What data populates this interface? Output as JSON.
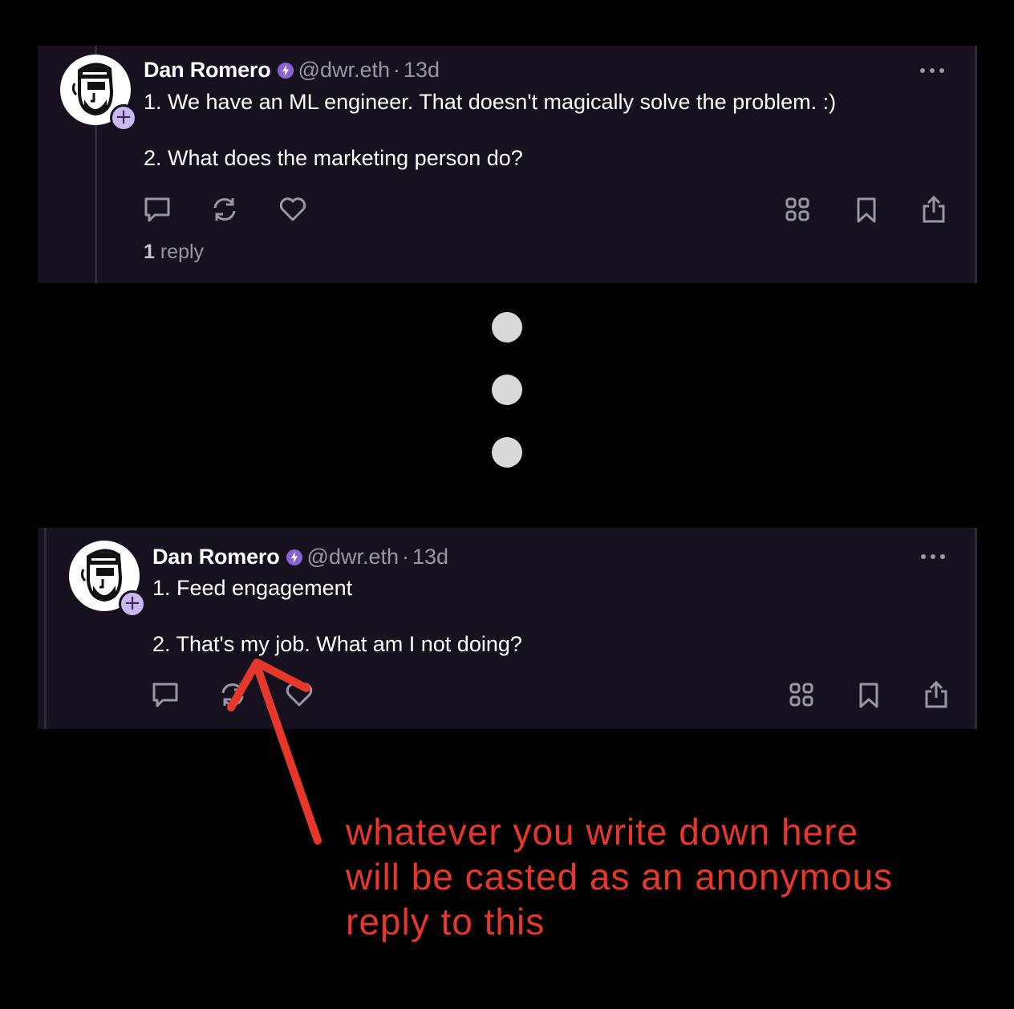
{
  "casts": [
    {
      "author": {
        "display_name": "Dan Romero",
        "handle": "@dwr.eth",
        "time_sep": "·",
        "time": "13d"
      },
      "lines": [
        "1. We have an ML engineer. That doesn't magically solve the problem. :)",
        "2. What does the marketing person do?"
      ],
      "reply_count": "1",
      "reply_label": "reply"
    },
    {
      "author": {
        "display_name": "Dan Romero",
        "handle": "@dwr.eth",
        "time_sep": "·",
        "time": "13d"
      },
      "lines": [
        "1. Feed engagement",
        "2. That's my job. What am I not doing?"
      ]
    }
  ],
  "annotation": {
    "lines": [
      "whatever you write down here",
      "will be casted as an anonymous",
      "reply to this"
    ],
    "color": "#e6382a"
  },
  "colors": {
    "background": "#000000",
    "card": "#17101f",
    "verified": "#8a63d2",
    "muted": "#9a97a3"
  },
  "icons": [
    "more-icon",
    "reply-icon",
    "recast-icon",
    "like-icon",
    "channels-icon",
    "bookmark-icon",
    "share-icon",
    "verified-badge-icon",
    "follow-plus-icon"
  ]
}
